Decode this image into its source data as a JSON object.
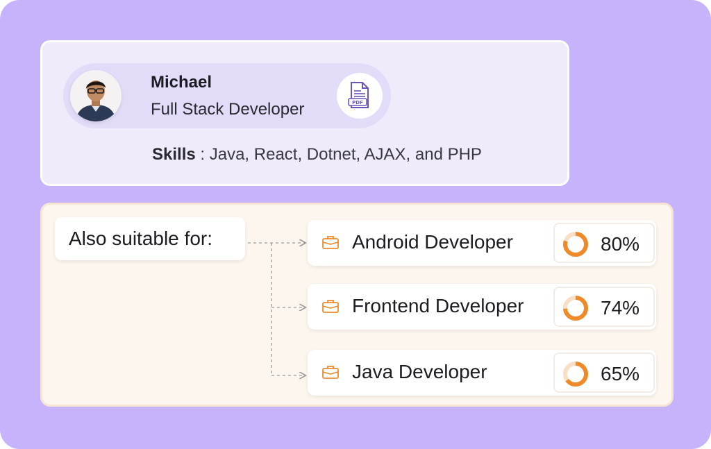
{
  "profile": {
    "name": "Michael",
    "role": "Full Stack Developer",
    "skills_label": "Skills",
    "skills_separator": " : ",
    "skills_value": "Java, React, Dotnet, AJAX, and PHP",
    "resume_icon": "pdf-file-icon"
  },
  "suggestions": {
    "label": "Also suitable for:",
    "jobs": [
      {
        "title": "Android Developer",
        "match": "80%",
        "fraction": 0.8,
        "icon": "briefcase-icon"
      },
      {
        "title": "Frontend Developer",
        "match": "74%",
        "fraction": 0.74,
        "icon": "briefcase-icon"
      },
      {
        "title": "Java Developer",
        "match": "65%",
        "fraction": 0.65,
        "icon": "briefcase-icon"
      }
    ]
  },
  "colors": {
    "background": "#c6b3fb",
    "accent": "#ee8a2a",
    "ring_track": "#f7dec4"
  }
}
